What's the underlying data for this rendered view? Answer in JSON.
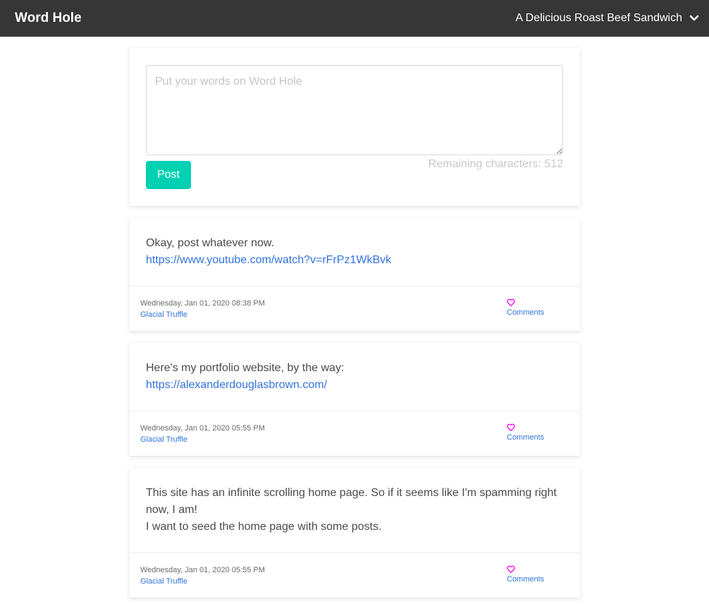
{
  "navbar": {
    "brand": "Word Hole",
    "user_name": "A Delicious Roast Beef Sandwich"
  },
  "composer": {
    "placeholder": "Put your words on Word Hole",
    "value": "",
    "post_label": "Post",
    "remaining_label": "Remaining characters: 512"
  },
  "posts": [
    {
      "text": "Okay, post whatever now.",
      "link": "https://www.youtube.com/watch?v=rFrPz1WkBvk",
      "timestamp": "Wednesday, Jan 01, 2020 08:38 PM",
      "author": "Glacial Truffle",
      "comments_label": "Comments"
    },
    {
      "text": "Here's my portfolio website, by the way:",
      "link": "https://alexanderdouglasbrown.com/",
      "timestamp": "Wednesday, Jan 01, 2020 05:55 PM",
      "author": "Glacial Truffle",
      "comments_label": "Comments"
    },
    {
      "text_lines": [
        "This site has an infinite scrolling home page. So if it seems like I'm spamming right now, I am!",
        "I want to seed the home page with some posts."
      ],
      "timestamp": "Wednesday, Jan 01, 2020 05:55 PM",
      "author": "Glacial Truffle",
      "comments_label": "Comments"
    }
  ],
  "icons": {
    "user_menu": "chevron-down-icon",
    "like": "heart-icon"
  },
  "colors": {
    "navbar_bg": "#363636",
    "primary": "#00d1b2",
    "link": "#3273dc",
    "heart": "#ff00ff"
  }
}
